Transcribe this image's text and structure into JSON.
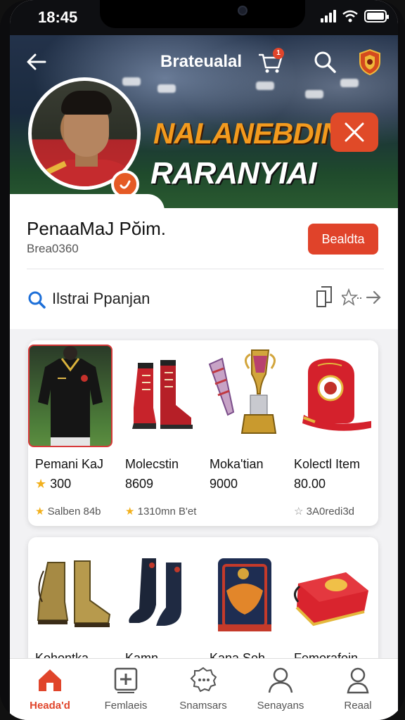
{
  "status": {
    "time": "18:45"
  },
  "header": {
    "title": "Brateualal",
    "cart_badge": "1",
    "headline": "NALANEBDIN",
    "subline": "RARANYIAI"
  },
  "profile": {
    "name": "PenaaMaJ Pŏim.",
    "handle": "Brea0360",
    "follow_label": "Bealdta"
  },
  "search": {
    "placeholder": "Ilstrai Ppanjan"
  },
  "items_row1": [
    {
      "name": "Pemani KaJ",
      "price": "300",
      "rating": "Salben 84b",
      "filled": true
    },
    {
      "name": "Molecstin",
      "price": "8609",
      "rating": "1310mn B'et",
      "filled": true
    },
    {
      "name": "Moka'tian",
      "price": "9000",
      "rating": "",
      "filled": false
    },
    {
      "name": "Kolectl Item",
      "price": "80.00",
      "rating": "3A0redi3d",
      "filled": false
    }
  ],
  "items_row2": [
    {
      "name": "Kohontka"
    },
    {
      "name": "Kamn"
    },
    {
      "name": "Kana Soh"
    },
    {
      "name": "Femorafoin"
    }
  ],
  "nav": [
    {
      "label": "Heada'd",
      "icon": "home-icon",
      "active": true
    },
    {
      "label": "Femlaeis",
      "icon": "add-square-icon",
      "active": false
    },
    {
      "label": "Snamsars",
      "icon": "chat-badge-icon",
      "active": false
    },
    {
      "label": "Senayans",
      "icon": "person-icon",
      "active": false
    },
    {
      "label": "Reaal",
      "icon": "profile-icon",
      "active": false
    }
  ],
  "colors": {
    "accent": "#e0452b",
    "headline": "#f39a1e",
    "star": "#f2b01c"
  }
}
